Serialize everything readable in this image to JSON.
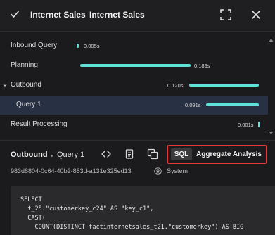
{
  "header": {
    "title_primary": "Internet Sales",
    "title_secondary": "Internet Sales"
  },
  "timeline": {
    "rows": [
      {
        "label": "Inbound Query",
        "value": "0.005s"
      },
      {
        "label": "Planning",
        "value": "0.189s"
      },
      {
        "label": "Outbound",
        "value": "0.120s"
      },
      {
        "label": "Query 1",
        "value": "0.091s"
      },
      {
        "label": "Result Processing",
        "value": "0.001s"
      }
    ]
  },
  "detail": {
    "title": "Outbound",
    "subtitle": "Query 1",
    "tabs": {
      "sql": "SQL",
      "aggregate": "Aggregate Analysis"
    },
    "query_id": "983d8804-0c64-40b2-883d-a131e325ed13",
    "user": "System"
  },
  "sql": {
    "code": "SELECT\n  t_25.\"customerkey_c24\" AS \"key_c1\",\n  CAST(\n    COUNT(DISTINCT factinternetsales_t21.\"customerkey\") AS BIG\n    ..."
  },
  "colors": {
    "accent_bar": "#5fe3d8",
    "selected_row": "#283043",
    "highlight_border": "#e23a3a"
  }
}
